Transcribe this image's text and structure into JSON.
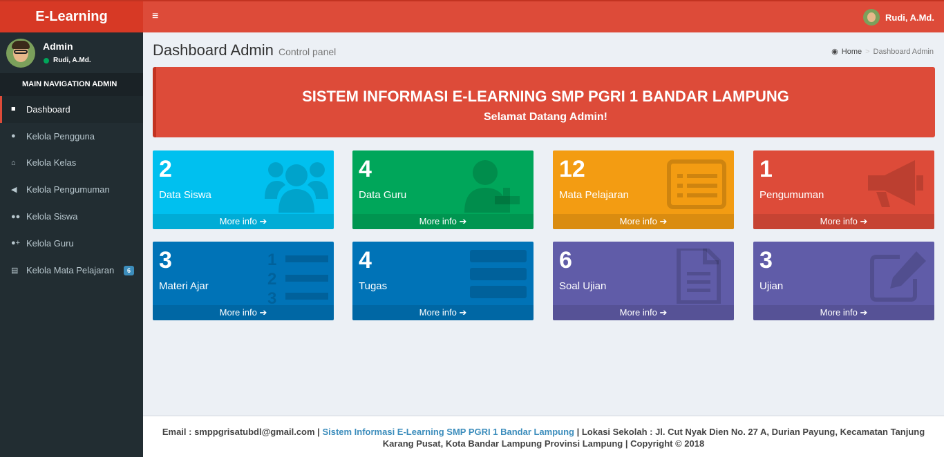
{
  "app": {
    "logo": "E-Learning",
    "menu_toggle": "≡",
    "top_user": "Rudi, A.Md."
  },
  "sidebar": {
    "user_name": "Admin",
    "user_status": "Rudi, A.Md.",
    "nav_header": "MAIN NAVIGATION ADMIN",
    "items": [
      {
        "label": "Dashboard",
        "icon": "dashboard-icon"
      },
      {
        "label": "Kelola Pengguna",
        "icon": "user-icon"
      },
      {
        "label": "Kelola Kelas",
        "icon": "home-icon"
      },
      {
        "label": "Kelola Pengumuman",
        "icon": "bullhorn-icon"
      },
      {
        "label": "Kelola Siswa",
        "icon": "users-icon"
      },
      {
        "label": "Kelola Guru",
        "icon": "user-plus-icon"
      },
      {
        "label": "Kelola Mata Pelajaran",
        "icon": "list-alt-icon",
        "badge": "6"
      }
    ]
  },
  "header": {
    "title": "Dashboard Admin",
    "subtitle": "Control panel",
    "breadcrumb_home": "Home",
    "breadcrumb_current": "Dashboard Admin"
  },
  "banner": {
    "title": "SISTEM INFORMASI E-LEARNING SMP PGRI 1 BANDAR LAMPUNG",
    "subtitle": "Selamat Datang Admin!"
  },
  "boxes": [
    {
      "value": "2",
      "label": "Data Siswa",
      "more": "More info ➔"
    },
    {
      "value": "4",
      "label": "Data Guru",
      "more": "More info ➔"
    },
    {
      "value": "12",
      "label": "Mata Pelajaran",
      "more": "More info ➔"
    },
    {
      "value": "1",
      "label": "Pengumuman",
      "more": "More info ➔"
    },
    {
      "value": "3",
      "label": "Materi Ajar",
      "more": "More info ➔"
    },
    {
      "value": "4",
      "label": "Tugas",
      "more": "More info ➔"
    },
    {
      "value": "6",
      "label": "Soal Ujian",
      "more": "More info ➔"
    },
    {
      "value": "3",
      "label": "Ujian",
      "more": "More info ➔"
    }
  ],
  "footer": {
    "email": "Email : smppgrisatubdl@gmail.com",
    "sep1": " | ",
    "link": "Sistem Informasi E-Learning SMP PGRI 1 Bandar Lampung",
    "rest": " | Lokasi Sekolah : Jl. Cut Nyak Dien No. 27 A, Durian Payung, Kecamatan Tanjung Karang Pusat, Kota Bandar Lampung Provinsi Lampung | Copyright © 2018"
  }
}
